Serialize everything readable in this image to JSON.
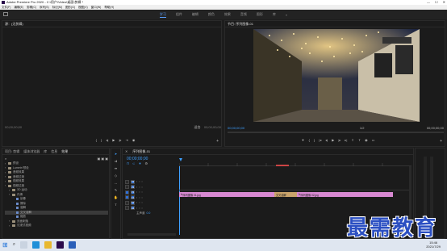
{
  "window": {
    "title": "Adobe Premiere Pro 2020 - C:\\用户\\Video\\桌面\\剪辑 *",
    "min": "—",
    "max": "☐",
    "close": "✕"
  },
  "menu": [
    "文件(F)",
    "编辑(E)",
    "剪辑(C)",
    "序列(S)",
    "标记(M)",
    "图形(G)",
    "视图(V)",
    "窗口(W)",
    "帮助(H)"
  ],
  "workspaces": {
    "tabs": [
      "学习",
      "组件",
      "编辑",
      "颜色",
      "效果",
      "音频",
      "图形",
      "库"
    ],
    "active_index": 0,
    "more": "»"
  },
  "source_monitor": {
    "title": "源：(无剪辑)",
    "timecode_left": "00;00;00;00",
    "timecode_right": "00;00;00;00"
  },
  "program_monitor": {
    "title": "节目: 序列图像-01",
    "timecode_left": "00;00;00;00",
    "fit": "适合",
    "ratio": "1/2",
    "timecode_right": "00;00;00;00"
  },
  "project_panel": {
    "tabs": [
      "项目: 剪辑",
      "媒体浏览器",
      "库",
      "信息",
      "效果"
    ],
    "active_tab": "效果",
    "items": [
      {
        "label": "预设",
        "indent": 0,
        "folder": true
      },
      {
        "label": "Lumetri 预设",
        "indent": 0,
        "folder": true
      },
      {
        "label": "音频效果",
        "indent": 0,
        "folder": true
      },
      {
        "label": "音频过渡",
        "indent": 0,
        "folder": true
      },
      {
        "label": "视频效果",
        "indent": 0,
        "folder": true
      },
      {
        "label": "视频过渡",
        "indent": 0,
        "folder": true
      },
      {
        "label": "3D 运动",
        "indent": 1,
        "folder": true
      },
      {
        "label": "内滑",
        "indent": 1,
        "folder": true
      },
      {
        "label": "划像",
        "indent": 2,
        "folder": false
      },
      {
        "label": "擦除",
        "indent": 2,
        "folder": false
      },
      {
        "label": "溶解",
        "indent": 2,
        "folder": false
      },
      {
        "label": "交叉溶解",
        "indent": 2,
        "folder": false,
        "selected": true
      },
      {
        "label": "缩放",
        "indent": 2,
        "folder": false
      },
      {
        "label": "页面剥落",
        "indent": 1,
        "folder": true
      },
      {
        "label": "沉浸式视频",
        "indent": 1,
        "folder": true
      }
    ]
  },
  "timeline": {
    "title": "序列图像-01",
    "timecode": "00;00;00;00",
    "tracks_video": [
      "V3",
      "V2",
      "V1"
    ],
    "tracks_audio": [
      "A1",
      "A2",
      "A3"
    ],
    "master": "主声道",
    "master_value": "0.0",
    "clips": [
      {
        "label": "序列图像 01.jpg",
        "color": "#d889d2"
      },
      {
        "label": "交叉溶解",
        "color": "#c9a36a"
      },
      {
        "label": "序列图像 02.jpg",
        "color": "#d889d2"
      }
    ]
  },
  "watermark": "最需教育",
  "taskbar": {
    "time": "15:46",
    "date": "2021/7/29"
  }
}
